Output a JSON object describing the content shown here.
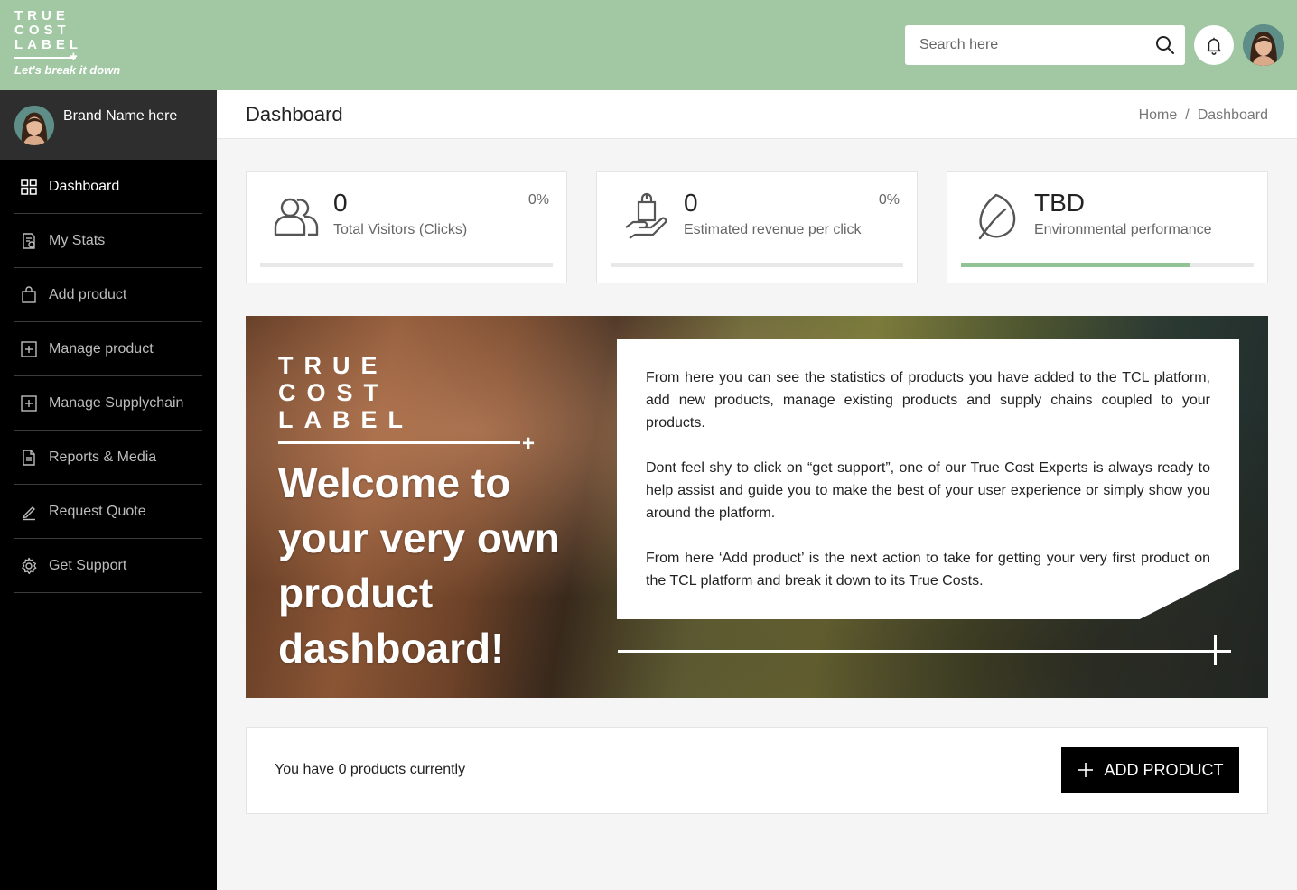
{
  "logo": {
    "lines": [
      "TRUE",
      "COST",
      "LABEL"
    ],
    "tagline": "Let's break it down"
  },
  "header": {
    "search_placeholder": "Search here"
  },
  "sidebar": {
    "brand_name": "Brand Name here",
    "items": [
      {
        "label": "Dashboard",
        "icon": "grid-icon",
        "active": true
      },
      {
        "label": "My Stats",
        "icon": "stats-document-icon",
        "active": false
      },
      {
        "label": "Add product",
        "icon": "shopping-bag-icon",
        "active": false
      },
      {
        "label": "Manage product",
        "icon": "plus-square-icon",
        "active": false
      },
      {
        "label": "Manage Supplychain",
        "icon": "plus-square-icon",
        "active": false
      },
      {
        "label": "Reports & Media",
        "icon": "document-icon",
        "active": false
      },
      {
        "label": "Request Quote",
        "icon": "pen-icon",
        "active": false
      },
      {
        "label": "Get Support",
        "icon": "gear-icon",
        "active": false
      }
    ]
  },
  "page": {
    "title": "Dashboard",
    "breadcrumb": [
      "Home",
      "Dashboard"
    ]
  },
  "stats": [
    {
      "value": "0",
      "label": "Total Visitors (Clicks)",
      "percent": "0%",
      "progress": 0,
      "icon": "users-icon"
    },
    {
      "value": "0",
      "label": "Estimated revenue per click",
      "percent": "0%",
      "progress": 0,
      "icon": "hand-bag-icon"
    },
    {
      "value": "TBD",
      "label": "Environmental performance",
      "percent": "",
      "progress": 0.78,
      "icon": "leaf-icon"
    }
  ],
  "banner": {
    "logo_lines": [
      "TRUE",
      "COST",
      "LABEL"
    ],
    "welcome": "Welcome to your very own product dashboard!",
    "paragraphs": [
      "From here you can see the statistics of products you have added to the TCL platform, add new products, manage existing products and supply chains coupled to your products.",
      "Dont feel shy to click on “get support”, one of our True Cost Experts is always ready to help assist and guide you to make the best of your user experience or simply show you around the platform.",
      "From here ‘Add product’ is the next action to take for getting your very first product on the TCL platform and break it down to its True Costs."
    ]
  },
  "products": {
    "count_text": "You have 0 products currently",
    "add_button": "ADD PRODUCT"
  },
  "colors": {
    "header_bg": "#a1c8a3",
    "sidebar_bg": "#000000",
    "brand_block_bg": "#2e2e2e",
    "progress_fill": "#92c394",
    "button_bg": "#000000"
  }
}
